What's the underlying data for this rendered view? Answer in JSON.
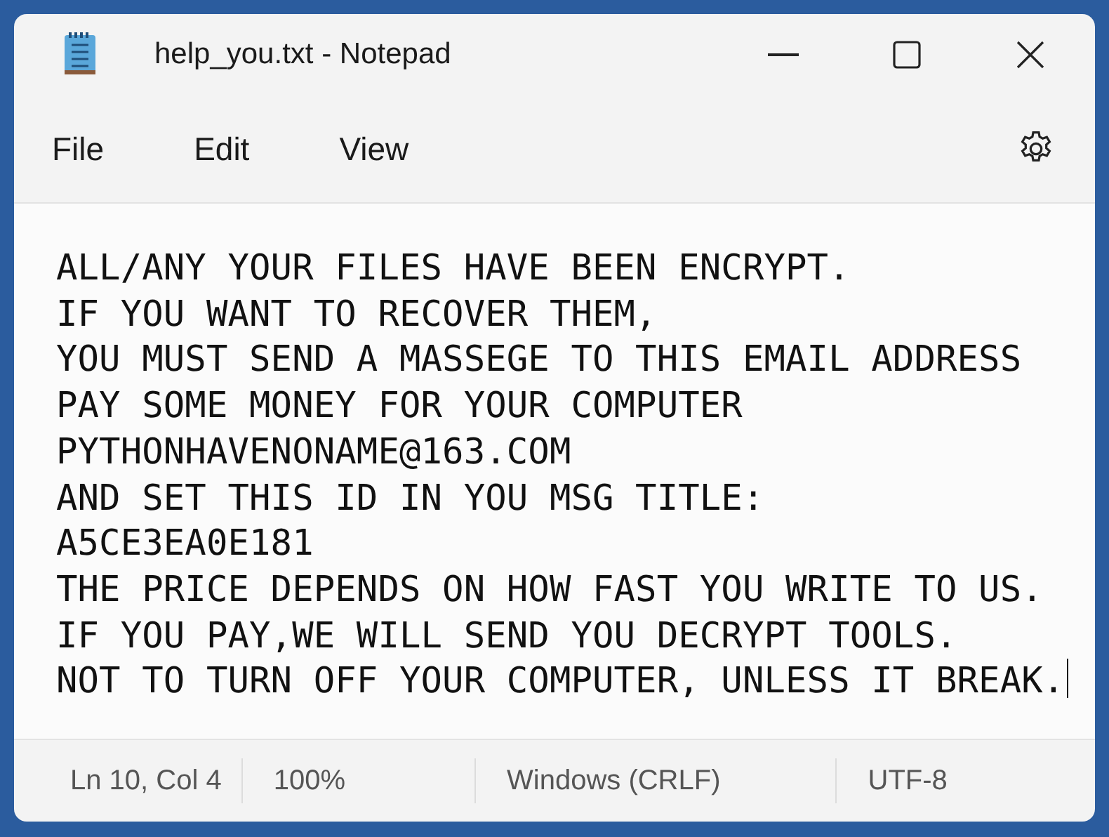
{
  "window": {
    "title": "help_you.txt - Notepad"
  },
  "menu": [
    {
      "label": "File"
    },
    {
      "label": "Edit"
    },
    {
      "label": "View"
    }
  ],
  "document": {
    "lines": [
      "ALL/ANY YOUR FILES HAVE BEEN ENCRYPT.",
      "IF YOU WANT TO RECOVER THEM,",
      "YOU MUST SEND A MASSEGE TO THIS EMAIL ADDRESS",
      "PAY SOME MONEY FOR YOUR COMPUTER",
      "PYTHONHAVENONAME@163.COM",
      "AND SET THIS ID IN YOU MSG TITLE:",
      "A5CE3EA0E181",
      "THE PRICE DEPENDS ON HOW FAST YOU WRITE TO US.",
      "IF YOU PAY,WE WILL SEND YOU DECRYPT TOOLS.",
      "NOT TO TURN OFF YOUR COMPUTER, UNLESS IT BREAK."
    ]
  },
  "status_bar": [
    {
      "text": "Ln 10, Col 4"
    },
    {
      "text": "100%"
    },
    {
      "text": "Windows (CRLF)"
    },
    {
      "text": "UTF-8"
    }
  ]
}
